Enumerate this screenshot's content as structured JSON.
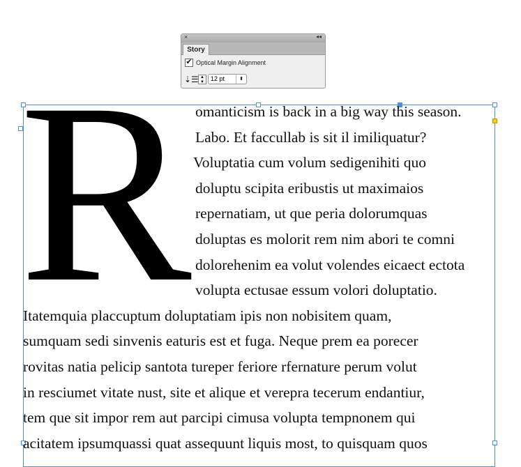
{
  "panel": {
    "close_icon": "×",
    "collapse_icon": "◂◂",
    "tab": "Story",
    "optical_margin_label": "Optical Margin Alignment",
    "optical_margin_checked": true,
    "size_value": "12 pt"
  },
  "story": {
    "drop_cap": "R",
    "lines": [
      "omanticism is back in a big way this season.",
      "Labo. Et faccullab is sit il imiliquatur?",
      "Voluptatia cum volum sedigenihiti quo",
      "doluptu scipita eribustis ut maximaios",
      "repernatiam, ut que peria dolorumquas",
      "doluptas es molorit rem nim abori te comni",
      "dolorehenim ea volut volendes eicaect ectota",
      "volupta ectusae essum volori doluptatio.",
      "Itatemquia placcuptum doluptatiam ipis non nobisitem quam,",
      "sumquam sedi sinvenis eaturis est et fuga. Neque prem ea porecer",
      "rovitas natia pelicip santota tureper feriore rfernature perum volut",
      "in resciumet vitate nust, site et alique et verepra tecerum endantiur,",
      "tem que sit impor rem aut parcipi cimusa volupta tempnonem qui",
      "acitatem ipsumquassi quat assequunt liquis most, to quisquam quos"
    ]
  }
}
